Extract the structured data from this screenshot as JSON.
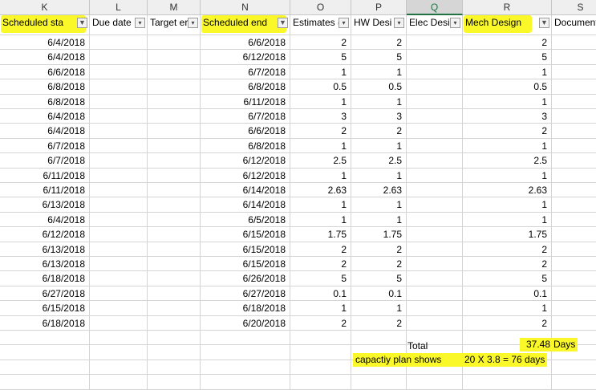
{
  "column_letters": [
    "K",
    "L",
    "M",
    "N",
    "O",
    "P",
    "Q",
    "R",
    "S"
  ],
  "selected_column": "Q",
  "headers": [
    {
      "label": "Scheduled sta",
      "filter": "active"
    },
    {
      "label": "Due date",
      "filter": "dropdown"
    },
    {
      "label": "Target er",
      "filter": "dropdown"
    },
    {
      "label": "Scheduled end",
      "filter": "active"
    },
    {
      "label": "Estimates (",
      "filter": "dropdown"
    },
    {
      "label": "HW Desi",
      "filter": "dropdown"
    },
    {
      "label": "Elec Desi",
      "filter": "dropdown"
    },
    {
      "label": "Mech Design",
      "filter": "active"
    },
    {
      "label": "Document",
      "filter": "none"
    }
  ],
  "rows": [
    {
      "start": "6/4/2018",
      "end": "6/6/2018",
      "est": "2",
      "hw": "2",
      "mech": "2"
    },
    {
      "start": "6/4/2018",
      "end": "6/12/2018",
      "est": "5",
      "hw": "5",
      "mech": "5"
    },
    {
      "start": "6/6/2018",
      "end": "6/7/2018",
      "est": "1",
      "hw": "1",
      "mech": "1"
    },
    {
      "start": "6/8/2018",
      "end": "6/8/2018",
      "est": "0.5",
      "hw": "0.5",
      "mech": "0.5"
    },
    {
      "start": "6/8/2018",
      "end": "6/11/2018",
      "est": "1",
      "hw": "1",
      "mech": "1"
    },
    {
      "start": "6/4/2018",
      "end": "6/7/2018",
      "est": "3",
      "hw": "3",
      "mech": "3"
    },
    {
      "start": "6/4/2018",
      "end": "6/6/2018",
      "est": "2",
      "hw": "2",
      "mech": "2"
    },
    {
      "start": "6/7/2018",
      "end": "6/8/2018",
      "est": "1",
      "hw": "1",
      "mech": "1"
    },
    {
      "start": "6/7/2018",
      "end": "6/12/2018",
      "est": "2.5",
      "hw": "2.5",
      "mech": "2.5"
    },
    {
      "start": "6/11/2018",
      "end": "6/12/2018",
      "est": "1",
      "hw": "1",
      "mech": "1"
    },
    {
      "start": "6/11/2018",
      "end": "6/14/2018",
      "est": "2.63",
      "hw": "2.63",
      "mech": "2.63"
    },
    {
      "start": "6/13/2018",
      "end": "6/14/2018",
      "est": "1",
      "hw": "1",
      "mech": "1"
    },
    {
      "start": "6/4/2018",
      "end": "6/5/2018",
      "est": "1",
      "hw": "1",
      "mech": "1"
    },
    {
      "start": "6/12/2018",
      "end": "6/15/2018",
      "est": "1.75",
      "hw": "1.75",
      "mech": "1.75"
    },
    {
      "start": "6/13/2018",
      "end": "6/15/2018",
      "est": "2",
      "hw": "2",
      "mech": "2"
    },
    {
      "start": "6/13/2018",
      "end": "6/15/2018",
      "est": "2",
      "hw": "2",
      "mech": "2"
    },
    {
      "start": "6/18/2018",
      "end": "6/26/2018",
      "est": "5",
      "hw": "5",
      "mech": "5"
    },
    {
      "start": "6/27/2018",
      "end": "6/27/2018",
      "est": "0.1",
      "hw": "0.1",
      "mech": "0.1"
    },
    {
      "start": "6/15/2018",
      "end": "6/18/2018",
      "est": "1",
      "hw": "1",
      "mech": "1"
    },
    {
      "start": "6/18/2018",
      "end": "6/20/2018",
      "est": "2",
      "hw": "2",
      "mech": "2"
    }
  ],
  "summary": {
    "total_label": "Total",
    "total_value": "37.48",
    "total_unit": "Days",
    "capacity_label": "capactiy plan shows",
    "capacity_value": "20 X 3.8 = 76 days"
  },
  "colors": {
    "highlight": "#fbf82a",
    "grid": "#d4d4d4",
    "header_bg": "#efefef",
    "selected_header": "#217346"
  }
}
